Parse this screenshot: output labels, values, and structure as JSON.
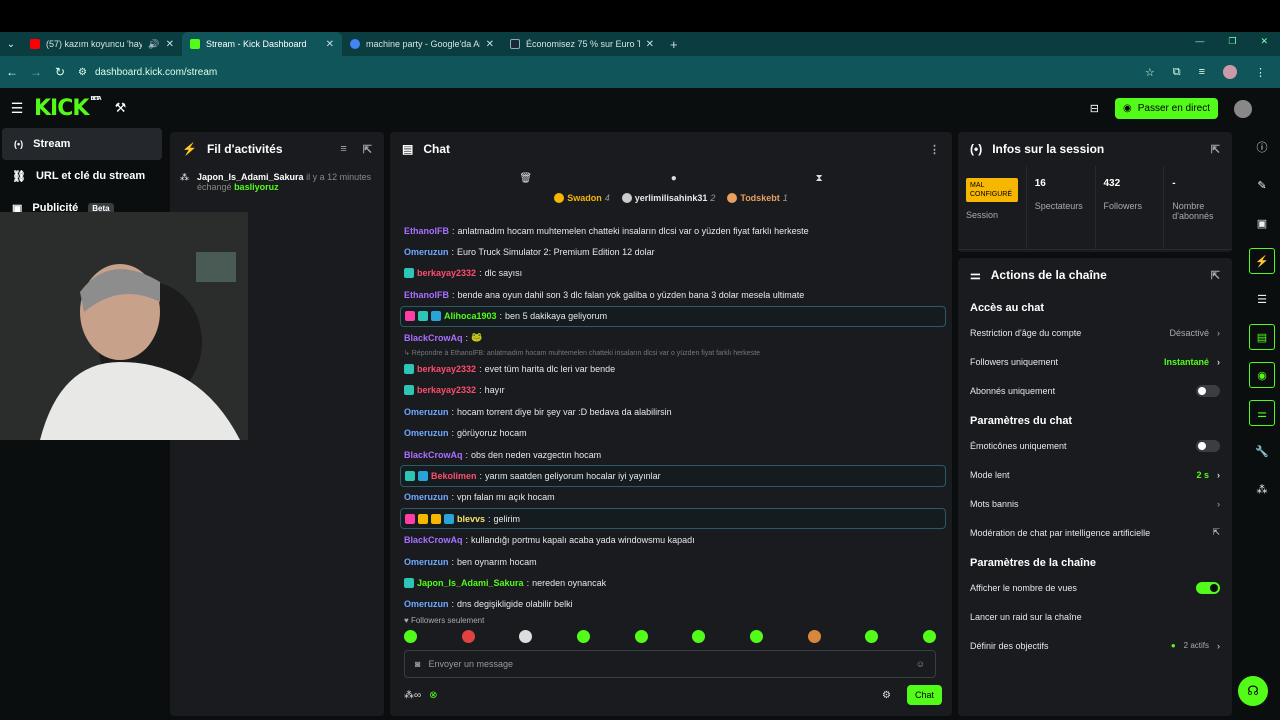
{
  "browser": {
    "tabs": [
      {
        "title": "(57) kazım koyuncu 'hayde",
        "fav": "#f00"
      },
      {
        "title": "Stream - Kick Dashboard",
        "fav": "#53fc18"
      },
      {
        "title": "machine party - Google'da Ara",
        "fav": "#4285f4"
      },
      {
        "title": "Économisez 75 % sur Euro Truc",
        "fav": "#1b2838"
      }
    ],
    "url": "dashboard.kick.com/stream"
  },
  "kick": {
    "logo": "KICK",
    "beta": "BETA",
    "live_button": "Passer en direct"
  },
  "sidebar": {
    "items": [
      {
        "label": "Stream",
        "icon": "broadcast-icon"
      },
      {
        "label": "URL et clé du stream",
        "icon": "link-icon"
      },
      {
        "label": "Publicité",
        "icon": "ad-icon",
        "badge": "Beta"
      }
    ]
  },
  "activity": {
    "title": "Fil d'activités",
    "item": {
      "user": "Japon_Is_Adami_Sakura",
      "time": "il y a 12 minutes",
      "action": "échangé",
      "reward": "basliyoruz"
    }
  },
  "chat": {
    "title": "Chat",
    "pins": [
      {
        "name": "Swadon",
        "count": "4",
        "color": "#f7b600"
      },
      {
        "name": "yerlimilisahink31",
        "count": "2",
        "color": "#cccccc"
      },
      {
        "name": "Todskebt",
        "count": "1",
        "color": "#e8a060"
      }
    ],
    "messages": [
      {
        "user": "EthanolFB",
        "color": "#a970ff",
        "text": "anlatmadım hocam muhtemelen chatteki insaların dlcsi var o yüzden fiyat farklı herkeste"
      },
      {
        "user": "Omeruzun",
        "color": "#6fa8ff",
        "text": "Euro Truck Simulator 2: Premium Edition 12 dolar"
      },
      {
        "user": "berkayay2332",
        "color": "#ff4d6d",
        "text": "dlc sayısı",
        "badges": [
          "#2ec4b6"
        ]
      },
      {
        "user": "EthanolFB",
        "color": "#a970ff",
        "text": "bende ana oyun dahil son 3 dlc falan yok galiba o yüzden bana 3 dolar mesela ultimate"
      },
      {
        "user": "Alihoca1903",
        "color": "#53fc18",
        "text": "ben 5 dakikaya geliyorum",
        "hl": true,
        "badges": [
          "#ff3da5",
          "#2ec4b6",
          "#2aa3d8"
        ]
      },
      {
        "user": "BlackCrowAq",
        "color": "#a970ff",
        "text": "🐸"
      },
      {
        "reply": "↳ Répondre à EthanolFB: anlatmadım hocam muhtemelen chatteki insaların dlcsi var o yüzden fiyat farklı herkeste"
      },
      {
        "user": "berkayay2332",
        "color": "#ff4d6d",
        "text": "evet tüm harita dlc leri var bende",
        "badges": [
          "#2ec4b6"
        ]
      },
      {
        "user": "berkayay2332",
        "color": "#ff4d6d",
        "text": "hayır",
        "badges": [
          "#2ec4b6"
        ]
      },
      {
        "user": "Omeruzun",
        "color": "#6fa8ff",
        "text": "hocam torrent diye bir şey var :D bedava da alabilirsin"
      },
      {
        "user": "Omeruzun",
        "color": "#6fa8ff",
        "text": "görüyoruz hocam"
      },
      {
        "user": "BlackCrowAq",
        "color": "#a970ff",
        "text": "obs den neden vazgectın hocam"
      },
      {
        "user": "Bekolimen",
        "color": "#ff4d6d",
        "text": "yarım saatden geliyorum hocalar iyi yayınlar",
        "hl": true,
        "badges": [
          "#2ec4b6",
          "#2aa3d8"
        ]
      },
      {
        "user": "Omeruzun",
        "color": "#6fa8ff",
        "text": "vpn falan mı açık hocam"
      },
      {
        "user": "blevvs",
        "color": "#f7e26b",
        "text": "gelirim",
        "hl": true,
        "badges": [
          "#ff3da5",
          "#f7b600",
          "#f7b600",
          "#2aa3d8"
        ]
      },
      {
        "user": "BlackCrowAq",
        "color": "#a970ff",
        "text": "kullandığı portmu kapalı acaba yada windowsmu kapadı"
      },
      {
        "user": "Omeruzun",
        "color": "#6fa8ff",
        "text": "ben oynarım hocam"
      },
      {
        "user": "Japon_Is_Adami_Sakura",
        "color": "#53fc18",
        "text": "nereden oynancak",
        "badges": [
          "#2ec4b6"
        ]
      },
      {
        "user": "Omeruzun",
        "color": "#6fa8ff",
        "text": "dns degişikligide olabilir belki"
      }
    ],
    "followers_only": "♥ Followers seulement",
    "placeholder": "Envoyer un message",
    "send": "Chat"
  },
  "session": {
    "title": "Infos sur la session",
    "status": "MAL CONFIGURÉ",
    "stats": [
      {
        "value": "16",
        "label": "Spectateurs"
      },
      {
        "value": "432",
        "label": "Followers"
      },
      {
        "value": "-",
        "label": "Nombre d'abonnés"
      }
    ],
    "status_label": "Session"
  },
  "actions": {
    "title": "Actions de la chaîne",
    "chat_access": "Accès au chat",
    "age": "Restriction d'âge du compte",
    "age_val": "Désactivé",
    "followers": "Followers uniquement",
    "followers_val": "Instantané",
    "subs": "Abonnés uniquement",
    "chat_params": "Paramètres du chat",
    "emotes": "Émoticônes uniquement",
    "slow": "Mode lent",
    "slow_val": "2 s",
    "banned": "Mots bannis",
    "ai_mod": "Modération de chat par intelligence artificielle",
    "channel_params": "Paramètres de la chaîne",
    "views": "Afficher le nombre de vues",
    "raid": "Lancer un raid sur la chaîne",
    "goals": "Définir des objectifs",
    "goals_val": "2 actifs"
  }
}
